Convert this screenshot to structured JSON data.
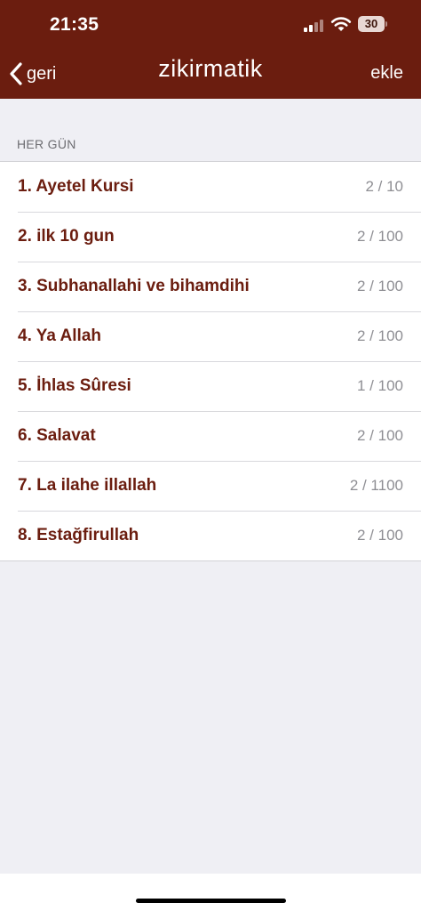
{
  "status_bar": {
    "time": "21:35",
    "battery": "30"
  },
  "nav": {
    "back_label": "geri",
    "title": "zikirmatik",
    "add_label": "ekle"
  },
  "section": {
    "header": "HER GÜN"
  },
  "items": [
    {
      "title": "1. Ayetel Kursi",
      "count": "2 / 10"
    },
    {
      "title": "2. ilk 10 gun",
      "count": "2 / 100"
    },
    {
      "title": "3. Subhanallahi ve bihamdihi",
      "count": "2 / 100"
    },
    {
      "title": "4. Ya Allah",
      "count": "2 / 100"
    },
    {
      "title": "5. İhlas Sûresi",
      "count": "1 / 100"
    },
    {
      "title": "6. Salavat",
      "count": "2 / 100"
    },
    {
      "title": "7. La ilahe illallah",
      "count": "2 / 1100"
    },
    {
      "title": "8. Estağfirullah",
      "count": "2 / 100"
    }
  ],
  "colors": {
    "brand": "#6b1d0f",
    "background": "#efeff4",
    "secondary_text": "#8e8e93"
  }
}
